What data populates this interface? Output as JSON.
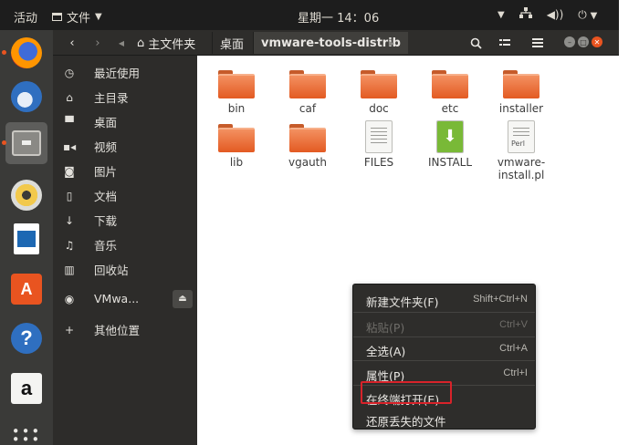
{
  "topbar": {
    "activities": "活动",
    "app_menu": "文件",
    "clock": "星期一 14：06"
  },
  "dock": {
    "items": [
      {
        "icon": "firefox-icon",
        "running": true
      },
      {
        "icon": "thunderbird-icon",
        "running": false
      },
      {
        "icon": "files-icon",
        "running": true,
        "active": true
      },
      {
        "icon": "rhythmbox-icon",
        "running": false
      },
      {
        "icon": "libreoffice-writer-icon",
        "running": false
      },
      {
        "icon": "software-center-icon",
        "running": false,
        "glyph": "A"
      },
      {
        "icon": "help-icon",
        "running": false,
        "glyph": "?"
      },
      {
        "icon": "amazon-icon",
        "running": false,
        "glyph": "a"
      },
      {
        "icon": "show-apps-icon",
        "running": false
      }
    ]
  },
  "headerbar": {
    "home_label": "主文件夹",
    "desktop_label": "桌面",
    "current_folder": "vmware-tools-distrib"
  },
  "sidebar": {
    "items": [
      {
        "icon": "recent-icon",
        "label": "最近使用"
      },
      {
        "icon": "home-icon",
        "label": "主目录"
      },
      {
        "icon": "desktop-icon",
        "label": "桌面"
      },
      {
        "icon": "video-icon",
        "label": "视频"
      },
      {
        "icon": "pictures-icon",
        "label": "图片"
      },
      {
        "icon": "documents-icon",
        "label": "文档"
      },
      {
        "icon": "downloads-icon",
        "label": "下载"
      },
      {
        "icon": "music-icon",
        "label": "音乐"
      },
      {
        "icon": "trash-icon",
        "label": "回收站"
      },
      {
        "icon": "disc-icon",
        "label": "VMwa..."
      },
      {
        "icon": "plus-icon",
        "label": "其他位置"
      }
    ]
  },
  "files": [
    {
      "name": "bin",
      "kind": "folder"
    },
    {
      "name": "caf",
      "kind": "folder"
    },
    {
      "name": "doc",
      "kind": "folder"
    },
    {
      "name": "etc",
      "kind": "folder"
    },
    {
      "name": "installer",
      "kind": "folder"
    },
    {
      "name": "lib",
      "kind": "folder"
    },
    {
      "name": "vgauth",
      "kind": "folder"
    },
    {
      "name": "FILES",
      "kind": "text"
    },
    {
      "name": "INSTALL",
      "kind": "install"
    },
    {
      "name": "vmware-install.pl",
      "kind": "perl",
      "badge": "Perl"
    }
  ],
  "context_menu": {
    "items": [
      {
        "label": "新建文件夹(F)",
        "shortcut": "Shift+Ctrl+N",
        "enabled": true
      },
      {
        "label": "粘贴(P)",
        "shortcut": "Ctrl+V",
        "enabled": false
      },
      {
        "label": "全选(A)",
        "shortcut": "Ctrl+A",
        "enabled": true
      },
      {
        "label": "属性(P)",
        "shortcut": "Ctrl+I",
        "enabled": true
      },
      {
        "label": "在终端打开(E)",
        "shortcut": "",
        "enabled": true,
        "highlighted": true
      },
      {
        "label": "还原丢失的文件",
        "shortcut": "",
        "enabled": true
      }
    ]
  },
  "colors": {
    "accent": "#e95420",
    "highlight_box": "#d8232a",
    "panel": "#1d1d1d",
    "dock": "#3a3a38"
  }
}
